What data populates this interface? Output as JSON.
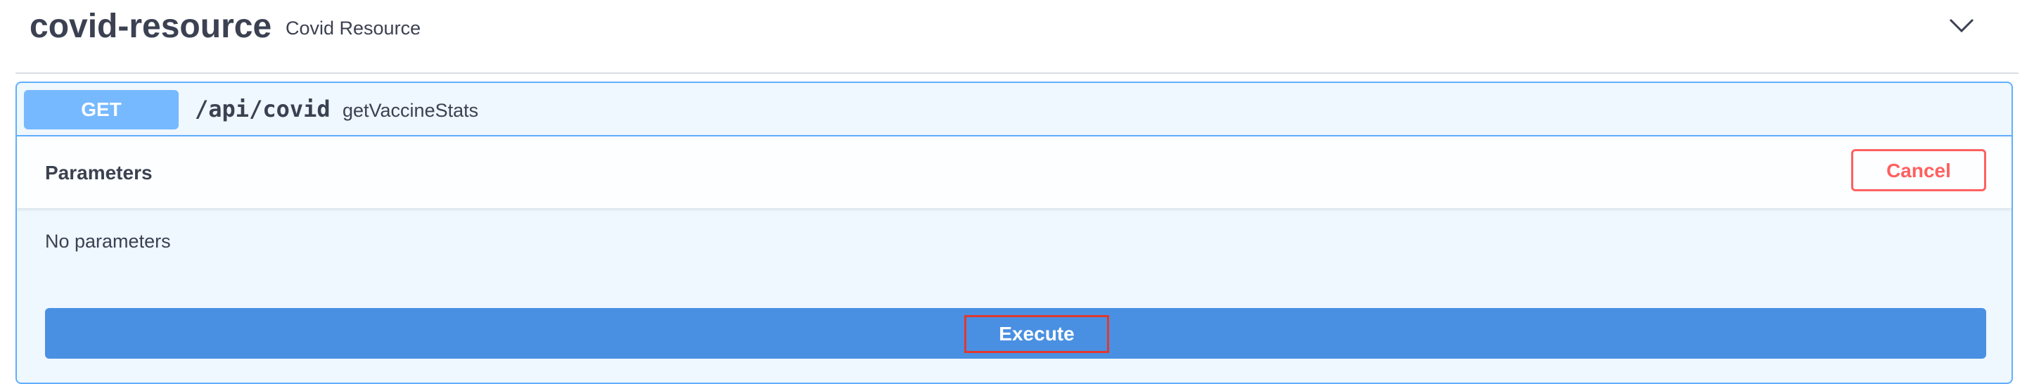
{
  "tag": {
    "name": "covid-resource",
    "description": "Covid Resource",
    "collapse_icon": "chevron-down-icon"
  },
  "operation": {
    "method": "GET",
    "path": "/api/covid",
    "summary": "getVaccineStats",
    "method_color": "#61affe"
  },
  "parameters": {
    "title": "Parameters",
    "cancel_label": "Cancel",
    "empty_text": "No parameters"
  },
  "execute": {
    "label": "Execute",
    "color": "#4990e2"
  }
}
